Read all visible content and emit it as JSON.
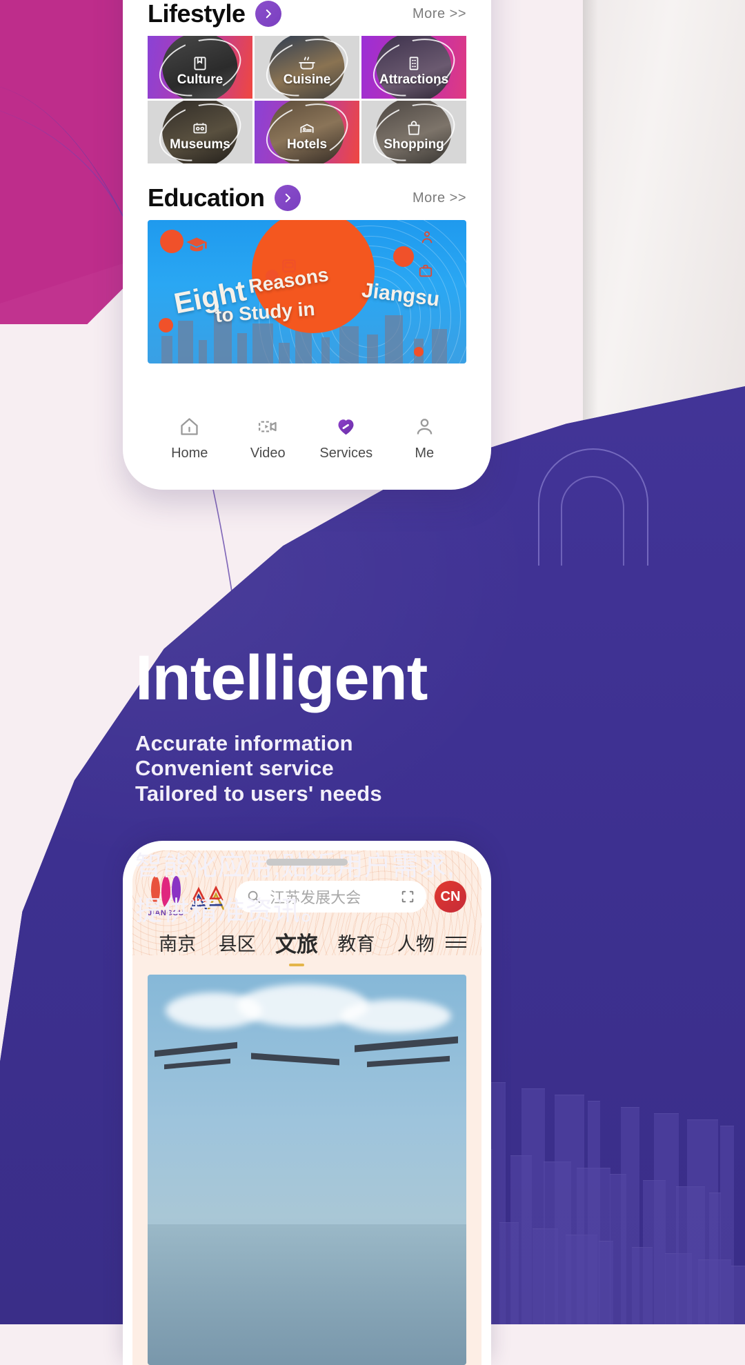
{
  "phone1": {
    "lifestyle": {
      "title": "Lifestyle",
      "more": "More >>",
      "arrow_icon": "chevron-right-icon",
      "tiles": [
        {
          "label": "Culture",
          "icon": "book-icon"
        },
        {
          "label": "Cuisine",
          "icon": "pot-icon"
        },
        {
          "label": "Attractions",
          "icon": "tower-icon"
        },
        {
          "label": "Museums",
          "icon": "museum-icon"
        },
        {
          "label": "Hotels",
          "icon": "bed-icon"
        },
        {
          "label": "Shopping",
          "icon": "bag-icon"
        }
      ]
    },
    "education": {
      "title": "Education",
      "more": "More >>",
      "arrow_icon": "chevron-right-icon",
      "banner": {
        "word1": "Eight",
        "word2": "Reasons",
        "word3": "to Study in",
        "word4": "Jiangsu",
        "icons": [
          "graduation-cap-icon",
          "bus-icon",
          "person-icon",
          "briefcase-icon"
        ]
      }
    },
    "tabbar": [
      {
        "label": "Home",
        "icon": "home-icon",
        "active": false
      },
      {
        "label": "Video",
        "icon": "video-icon",
        "active": false
      },
      {
        "label": "Services",
        "icon": "heart-icon",
        "active": true
      },
      {
        "label": "Me",
        "icon": "person-icon",
        "active": false
      }
    ]
  },
  "hero": {
    "title": "Intelligent",
    "sub_lines": [
      "Accurate information",
      "Convenient service",
      "Tailored to users' needs"
    ],
    "cn_lines": [
      "智能化应用,贴近用户需求,",
      "提供精准资讯。"
    ]
  },
  "phone2": {
    "logo": {
      "word": "JIANGSU",
      "petal_colors": [
        "#e8523c",
        "#e0267e",
        "#8a33c4"
      ]
    },
    "search": {
      "placeholder": "江苏发展大会",
      "search_icon": "search-icon",
      "scan_icon": "scan-icon"
    },
    "lang_button": "CN",
    "nav": [
      {
        "label": "南京",
        "active": false
      },
      {
        "label": "县区",
        "active": false
      },
      {
        "label": "文旅",
        "active": true
      },
      {
        "label": "教育",
        "active": false
      },
      {
        "label": "人物",
        "active": false
      }
    ],
    "menu_icon": "hamburger-icon"
  },
  "colors": {
    "brand_purple": "#3e3191",
    "accent_purple": "#7a3fc0",
    "accent_magenta": "#c1338f",
    "accent_orange": "#f4571f",
    "accent_gold": "#e4b54a"
  }
}
